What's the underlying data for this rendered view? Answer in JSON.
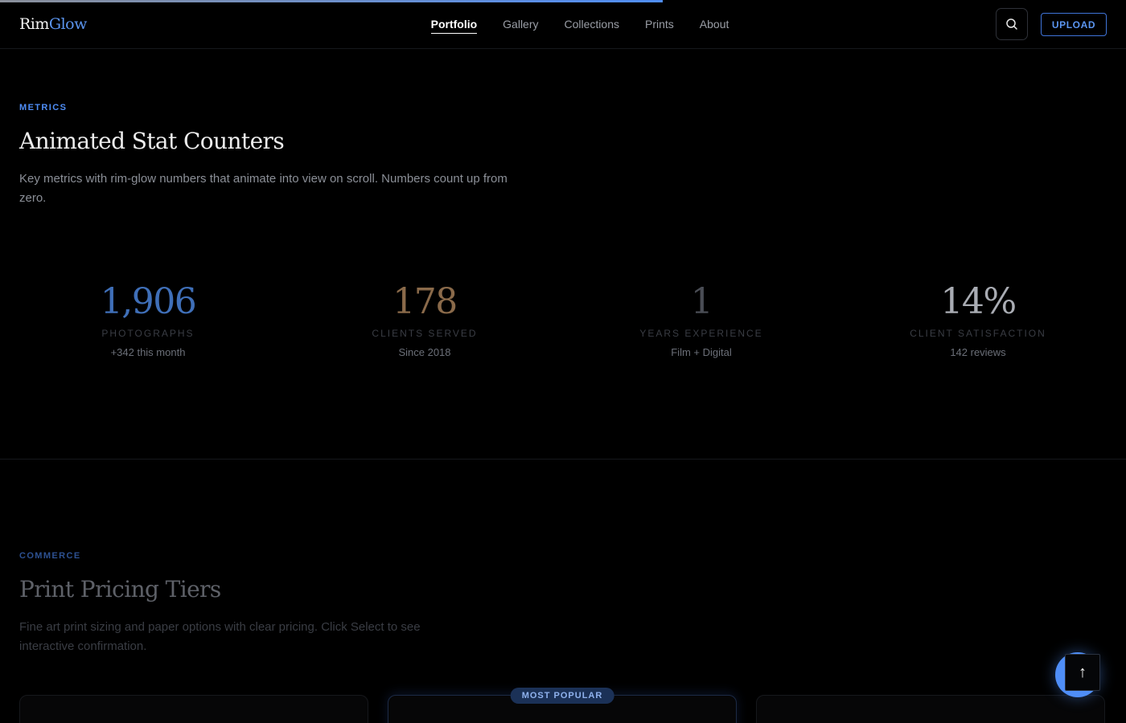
{
  "brand": {
    "part1": "Rim",
    "part2": "Glow"
  },
  "nav": {
    "items": [
      {
        "label": "Portfolio",
        "active": true
      },
      {
        "label": "Gallery"
      },
      {
        "label": "Collections"
      },
      {
        "label": "Prints"
      },
      {
        "label": "About"
      }
    ]
  },
  "header": {
    "search_icon": "search-icon",
    "upload_label": "UPLOAD"
  },
  "scroll_progress": 0.59,
  "metrics": {
    "eyebrow": "METRICS",
    "title": "Animated Stat Counters",
    "description": "Key metrics with rim-glow numbers that animate into view on scroll. Numbers count up from zero.",
    "stats": [
      {
        "value": "1,906",
        "label": "PHOTOGRAPHS",
        "sub": "+342 this month",
        "color": "#3f6fb8"
      },
      {
        "value": "178",
        "label": "CLIENTS SERVED",
        "sub": "Since 2018",
        "color": "#8a6a4a"
      },
      {
        "value": "1",
        "label": "YEARS EXPERIENCE",
        "sub": "Film + Digital",
        "color": "#4a4d55"
      },
      {
        "value": "14%",
        "label": "CLIENT SATISFACTION",
        "sub": "142 reviews",
        "color": "#a9acb3"
      }
    ]
  },
  "commerce": {
    "eyebrow": "COMMERCE",
    "title": "Print Pricing Tiers",
    "description": "Fine art print sizing and paper options with clear pricing. Click Select to see interactive confirmation.",
    "featured_badge": "MOST POPULAR"
  },
  "back_to_top": {
    "icon": "arrow-up-icon",
    "glyph": "↑"
  },
  "colors": {
    "accent": "#4f8ef7",
    "background": "#000000"
  }
}
